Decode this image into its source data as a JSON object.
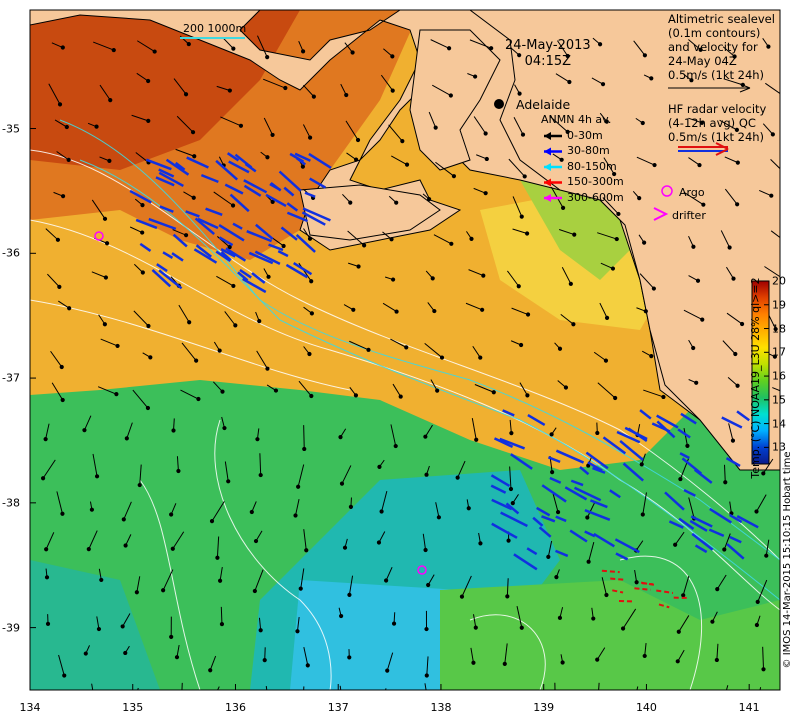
{
  "header": {
    "date": "24-May-2013",
    "time": "04:15Z"
  },
  "scale_bar": {
    "label": "200  1000m"
  },
  "city": {
    "name": "Adelaide"
  },
  "legend_sealevel": {
    "lines": [
      "Altimetric sealevel",
      "(0.1m contours)",
      "and velocity for",
      "24-May 04Z",
      "0.5m/s (1kt 24h)"
    ]
  },
  "legend_hf": {
    "lines": [
      "HF radar velocity",
      "(4-12h avg) QC",
      "0.5m/s (1kt 24h)"
    ]
  },
  "legend_anmn": {
    "title": "ANMN 4h av.",
    "items": [
      {
        "label": "0-30m",
        "color": "#000000"
      },
      {
        "label": "30-80m",
        "color": "#0000ff"
      },
      {
        "label": "80-150m",
        "color": "#00e0ff"
      },
      {
        "label": "150-300m",
        "color": "#ff0000"
      },
      {
        "label": "300-600m",
        "color": "#ff00ff"
      }
    ]
  },
  "markers": {
    "argo_label": "Argo",
    "drifter_label": "drifter",
    "argo_color": "#ff00ff",
    "drifter_color": "#ff00ff"
  },
  "axes": {
    "x_ticks": [
      "134",
      "135",
      "136",
      "137",
      "138",
      "139",
      "140",
      "141"
    ],
    "x_values": [
      134,
      135,
      136,
      137,
      138,
      139,
      140,
      141
    ],
    "y_ticks": [
      "-35",
      "-36",
      "-37",
      "-38",
      "-39"
    ],
    "y_values": [
      -35,
      -36,
      -37,
      -38,
      -39
    ],
    "lon_range": [
      134,
      141.3
    ],
    "lat_range": [
      -34.05,
      -39.5
    ]
  },
  "colorbar": {
    "title": "Temp. (°C) NOAA19_L3U 28% ql>=2",
    "ticks": [
      "20",
      "19",
      "18",
      "17",
      "16",
      "15",
      "14",
      "13"
    ],
    "min": 12.3,
    "max": 20,
    "colors": [
      "#0a1a8a",
      "#0040d0",
      "#00b0ff",
      "#00e0d0",
      "#20c060",
      "#60d020",
      "#c0e000",
      "#ffe000",
      "#ffb000",
      "#ff8000",
      "#e04000",
      "#a00000"
    ]
  },
  "credit": {
    "text": "© IMOS 14-Mar-2015 15:10:15 Hobart time"
  },
  "colors": {
    "land": "#f6c89a",
    "water_warm": "#e8a020",
    "water_cool": "#20b060"
  }
}
